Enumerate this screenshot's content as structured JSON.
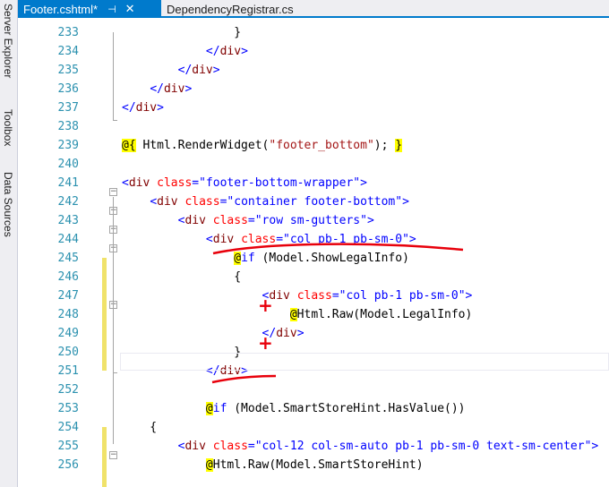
{
  "side_tabs": [
    "Server Explorer",
    "Toolbox",
    "Data Sources"
  ],
  "tabs": [
    {
      "label": "Footer.cshtml*",
      "active": true
    },
    {
      "label": "DependencyRegistrar.cs",
      "active": false
    }
  ],
  "icons": {
    "pin": "pin-icon",
    "close": "close-icon"
  },
  "colors": {
    "accent": "#007acc",
    "line_number": "#2b91af",
    "annotation": "#e8000b",
    "razor_highlight": "#ffff00"
  },
  "lines": [
    {
      "num": "233",
      "parts": [
        {
          "t": "                }",
          "c": "plain"
        }
      ]
    },
    {
      "num": "234",
      "parts": [
        {
          "t": "            ",
          "c": "plain"
        },
        {
          "t": "</",
          "c": "kw"
        },
        {
          "t": "div",
          "c": "tag"
        },
        {
          "t": ">",
          "c": "kw"
        }
      ]
    },
    {
      "num": "235",
      "parts": [
        {
          "t": "        ",
          "c": "plain"
        },
        {
          "t": "</",
          "c": "kw"
        },
        {
          "t": "div",
          "c": "tag"
        },
        {
          "t": ">",
          "c": "kw"
        }
      ]
    },
    {
      "num": "236",
      "parts": [
        {
          "t": "    ",
          "c": "plain"
        },
        {
          "t": "</",
          "c": "kw"
        },
        {
          "t": "div",
          "c": "tag"
        },
        {
          "t": ">",
          "c": "kw"
        }
      ]
    },
    {
      "num": "237",
      "parts": [
        {
          "t": "</",
          "c": "kw"
        },
        {
          "t": "div",
          "c": "tag"
        },
        {
          "t": ">",
          "c": "kw"
        }
      ]
    },
    {
      "num": "238",
      "parts": []
    },
    {
      "num": "239",
      "parts": [
        {
          "t": "@{",
          "c": "razor"
        },
        {
          "t": " Html.RenderWidget(",
          "c": "plain"
        },
        {
          "t": "\"footer_bottom\"",
          "c": "rstr"
        },
        {
          "t": "); ",
          "c": "plain"
        },
        {
          "t": "}",
          "c": "razor"
        }
      ]
    },
    {
      "num": "240",
      "parts": []
    },
    {
      "num": "241",
      "parts": [
        {
          "t": "<",
          "c": "kw"
        },
        {
          "t": "div",
          "c": "tag"
        },
        {
          "t": " ",
          "c": "plain"
        },
        {
          "t": "class",
          "c": "attr"
        },
        {
          "t": "=\"footer-bottom-wrapper\">",
          "c": "kw"
        }
      ]
    },
    {
      "num": "242",
      "parts": [
        {
          "t": "    ",
          "c": "plain"
        },
        {
          "t": "<",
          "c": "kw"
        },
        {
          "t": "div",
          "c": "tag"
        },
        {
          "t": " ",
          "c": "plain"
        },
        {
          "t": "class",
          "c": "attr"
        },
        {
          "t": "=\"container footer-bottom\">",
          "c": "kw"
        }
      ]
    },
    {
      "num": "243",
      "parts": [
        {
          "t": "        ",
          "c": "plain"
        },
        {
          "t": "<",
          "c": "kw"
        },
        {
          "t": "div",
          "c": "tag"
        },
        {
          "t": " ",
          "c": "plain"
        },
        {
          "t": "class",
          "c": "attr"
        },
        {
          "t": "=\"row sm-gutters\">",
          "c": "kw"
        }
      ]
    },
    {
      "num": "244",
      "parts": [
        {
          "t": "            ",
          "c": "plain"
        },
        {
          "t": "<",
          "c": "kw"
        },
        {
          "t": "div",
          "c": "tag"
        },
        {
          "t": " ",
          "c": "plain"
        },
        {
          "t": "class",
          "c": "attr"
        },
        {
          "t": "=\"col pb-1 pb-sm-0\">",
          "c": "kw"
        }
      ]
    },
    {
      "num": "245",
      "parts": [
        {
          "t": "                ",
          "c": "plain"
        },
        {
          "t": "@",
          "c": "razor"
        },
        {
          "t": "if",
          "c": "kw"
        },
        {
          "t": " (Model.ShowLegalInfo)",
          "c": "plain"
        }
      ]
    },
    {
      "num": "246",
      "parts": [
        {
          "t": "                {",
          "c": "plain"
        }
      ]
    },
    {
      "num": "247",
      "parts": [
        {
          "t": "                    ",
          "c": "plain"
        },
        {
          "t": "<",
          "c": "kw"
        },
        {
          "t": "div",
          "c": "tag"
        },
        {
          "t": " ",
          "c": "plain"
        },
        {
          "t": "class",
          "c": "attr"
        },
        {
          "t": "=\"col pb-1 pb-sm-0\">",
          "c": "kw"
        }
      ]
    },
    {
      "num": "248",
      "parts": [
        {
          "t": "                        ",
          "c": "plain"
        },
        {
          "t": "@",
          "c": "razor"
        },
        {
          "t": "Html.Raw(Model.LegalInfo)",
          "c": "plain"
        }
      ]
    },
    {
      "num": "249",
      "parts": [
        {
          "t": "                    ",
          "c": "plain"
        },
        {
          "t": "</",
          "c": "kw"
        },
        {
          "t": "div",
          "c": "tag"
        },
        {
          "t": ">",
          "c": "kw"
        }
      ]
    },
    {
      "num": "250",
      "parts": [
        {
          "t": "                }",
          "c": "plain"
        }
      ]
    },
    {
      "num": "251",
      "parts": [
        {
          "t": "            ",
          "c": "plain"
        },
        {
          "t": "</",
          "c": "kw"
        },
        {
          "t": "div",
          "c": "tag"
        },
        {
          "t": ">",
          "c": "kw"
        }
      ]
    },
    {
      "num": "252",
      "parts": []
    },
    {
      "num": "253",
      "parts": [
        {
          "t": "            ",
          "c": "plain"
        },
        {
          "t": "@",
          "c": "razor"
        },
        {
          "t": "if",
          "c": "kw"
        },
        {
          "t": " (Model.SmartStoreHint.HasValue())",
          "c": "plain"
        }
      ]
    },
    {
      "num": "254",
      "parts": [
        {
          "t": "    {",
          "c": "plain"
        }
      ]
    },
    {
      "num": "255",
      "parts": [
        {
          "t": "        ",
          "c": "plain"
        },
        {
          "t": "<",
          "c": "kw"
        },
        {
          "t": "div",
          "c": "tag"
        },
        {
          "t": " ",
          "c": "plain"
        },
        {
          "t": "class",
          "c": "attr"
        },
        {
          "t": "=\"col-12 col-sm-auto pb-1 pb-sm-0 text-sm-center\">",
          "c": "kw"
        }
      ]
    },
    {
      "num": "256",
      "parts": [
        {
          "t": "            ",
          "c": "plain"
        },
        {
          "t": "@",
          "c": "razor"
        },
        {
          "t": "Html.Raw(Model.SmartStoreHint)",
          "c": "plain"
        }
      ]
    }
  ]
}
